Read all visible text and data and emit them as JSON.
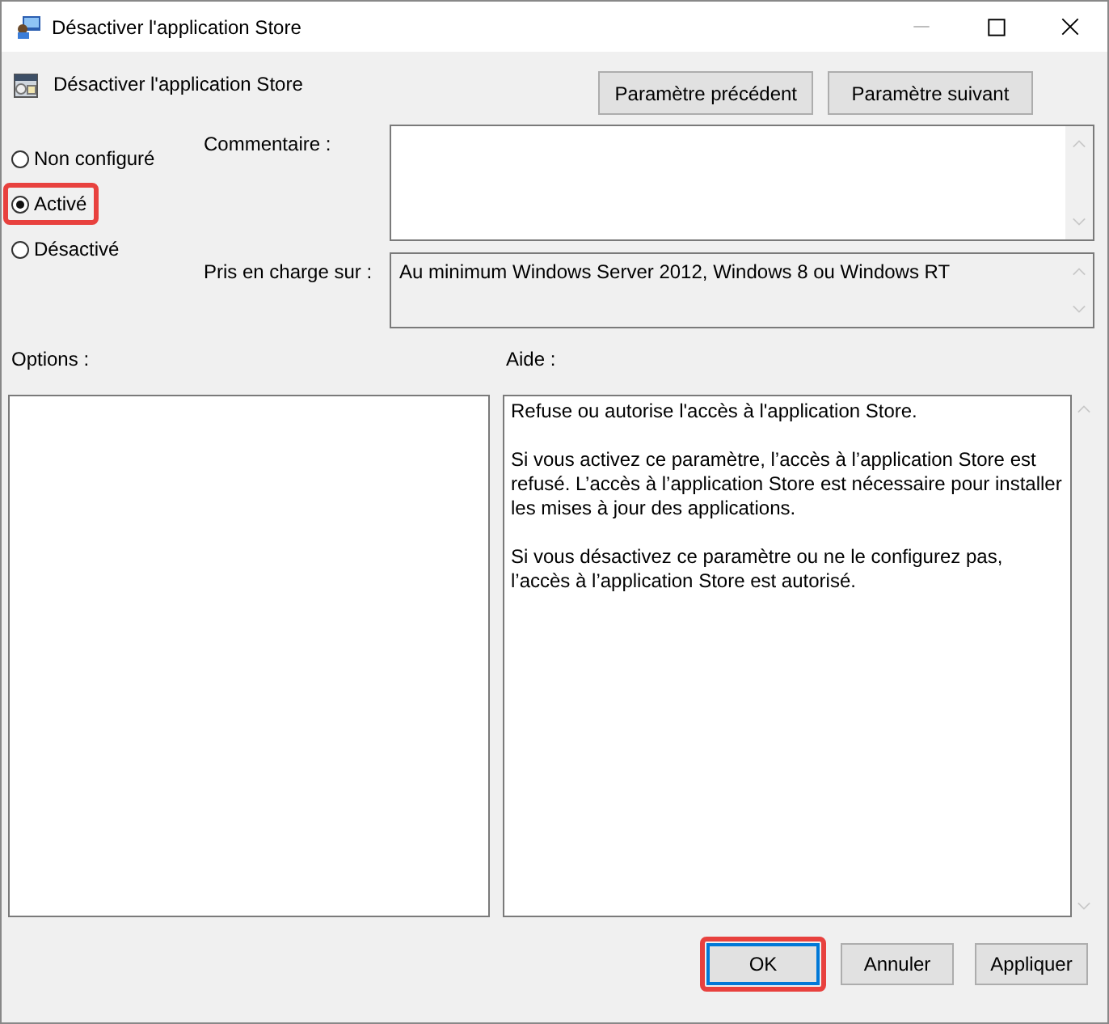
{
  "window": {
    "title": "Désactiver l'application Store"
  },
  "header": {
    "title": "Désactiver l'application Store",
    "nav_buttons": [
      "Paramètre précédent",
      "Paramètre suivant"
    ]
  },
  "states": [
    {
      "label": "Non configuré",
      "selected": false,
      "highlighted": false
    },
    {
      "label": "Activé",
      "selected": true,
      "highlighted": true
    },
    {
      "label": "Désactivé",
      "selected": false,
      "highlighted": false
    }
  ],
  "comment": {
    "label": "Commentaire :"
  },
  "supported": {
    "label": "Pris en charge sur :",
    "value": "Au minimum Windows Server 2012, Windows 8 ou Windows RT"
  },
  "options": {
    "label": "Options :"
  },
  "help": {
    "label": "Aide :",
    "paragraphs": [
      "Refuse ou autorise l'accès à l'application Store.",
      "Si vous activez ce paramètre, l’accès à l’application Store est refusé. L’accès à l’application Store est nécessaire pour installer les mises à jour des applications.",
      "Si vous désactivez ce paramètre ou ne le configurez pas, l’accès à l’application Store est autorisé."
    ]
  },
  "buttons": [
    {
      "label": "OK",
      "default": true,
      "highlighted": true
    },
    {
      "label": "Annuler",
      "default": false,
      "highlighted": false
    },
    {
      "label": "Appliquer",
      "default": false,
      "highlighted": false
    }
  ]
}
